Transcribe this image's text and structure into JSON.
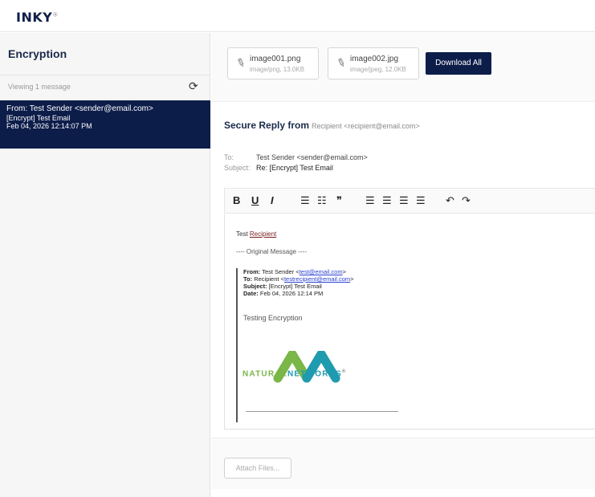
{
  "app": {
    "logo": "INKY",
    "logo_mark": "®"
  },
  "sidebar": {
    "title": "Encryption",
    "subtitle": "Viewing 1 message",
    "refresh_icon": "refresh-icon",
    "message": {
      "from": "From: Test Sender <sender@email.com>",
      "subject": "[Encrypt] Test Email",
      "date": "Feb 04, 2026 12:14:07 PM"
    }
  },
  "attachments": [
    {
      "name": "image001.png",
      "meta": "image/png, 13.0KB"
    },
    {
      "name": "image002.jpg",
      "meta": "image/jpeg, 12.0KB"
    }
  ],
  "download_all": "Download All",
  "reply": {
    "title": "Secure Reply from",
    "from_addr": "Recipient <recipient@email.com>",
    "to_label": "To:",
    "to_value": "Test Sender <sender@email.com>",
    "subject_label": "Subject:",
    "subject_value": "Re: [Encrypt] Test Email"
  },
  "toolbar": {
    "bold": "B",
    "underline": "U",
    "italic": "I",
    "ordered_list": "☰",
    "bullet_list": "☷",
    "quote": "❞",
    "align_left": "☰",
    "align_center": "☰",
    "align_right": "☰",
    "justify": "☰",
    "undo": "↶",
    "redo": "↷"
  },
  "editor": {
    "greeting": "Test",
    "greeting_link": "Recipient",
    "divider": "---- Original Message ----",
    "from_label": "From:",
    "from_value": "Test Sender <",
    "from_link": "test@email.com",
    "from_end": ">",
    "to_label": "To:",
    "to_value": "Recipient <",
    "to_link": "testrecipient@email.com",
    "to_end": ">",
    "subject_label": "Subject:",
    "subject_value": "[Encrypt] Test Email",
    "date_label": "Date:",
    "date_value": "Feb 04, 2026 12:14 PM",
    "body": "Testing Encryption",
    "logo_word_1": "NATURAL",
    "logo_word_2": "NETWORKS",
    "logo_mark": "®"
  },
  "attach_files": "Attach Files...",
  "colors": {
    "brand_navy": "#0d1d4a",
    "nn_blue": "#1f9bb0",
    "nn_green": "#7ab648",
    "link": "#2a3fd0"
  }
}
